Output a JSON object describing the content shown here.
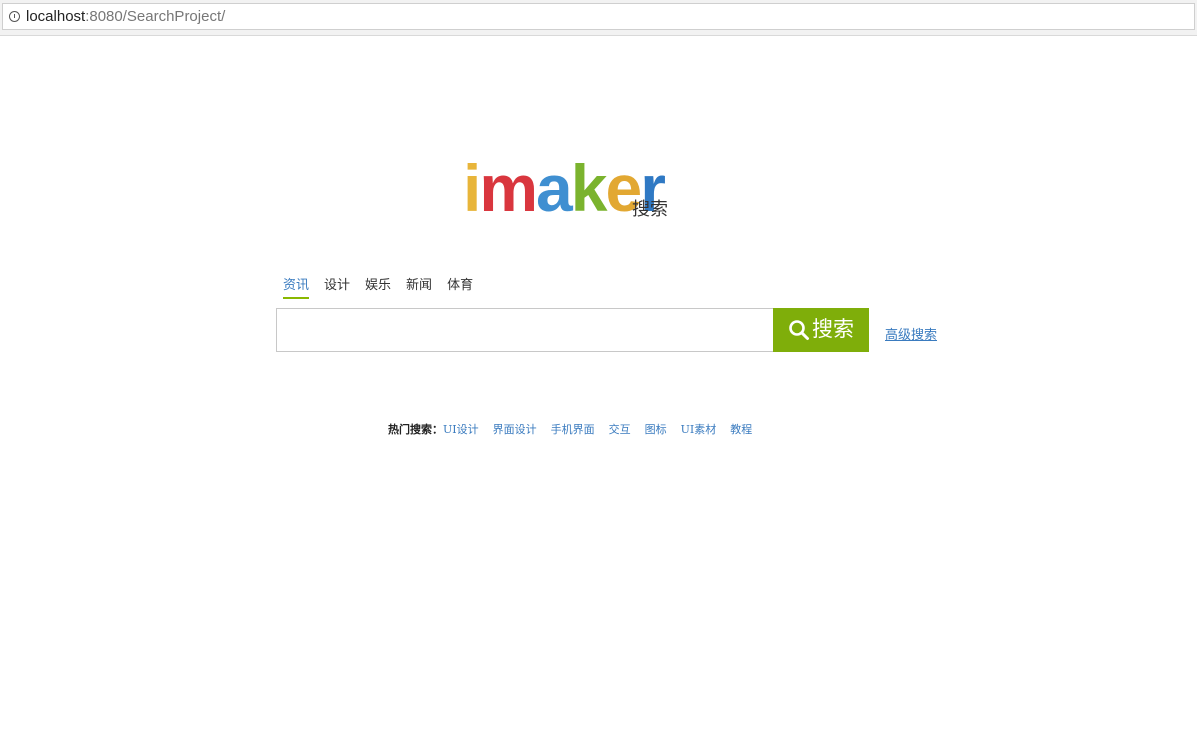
{
  "browser": {
    "url_host": "localhost",
    "url_rest": ":8080/SearchProject/"
  },
  "logo": {
    "letters": [
      {
        "char": "i",
        "color": "#e8b53a"
      },
      {
        "char": "m",
        "color": "#d9363e"
      },
      {
        "char": "a",
        "color": "#3f8fd1"
      },
      {
        "char": "k",
        "color": "#7bb32e"
      },
      {
        "char": "e",
        "color": "#e2a832"
      },
      {
        "char": "r",
        "color": "#2f79c4"
      }
    ],
    "sub": "搜索"
  },
  "tabs": [
    {
      "label": "资讯",
      "active": true
    },
    {
      "label": "设计",
      "active": false
    },
    {
      "label": "娱乐",
      "active": false
    },
    {
      "label": "新闻",
      "active": false
    },
    {
      "label": "体育",
      "active": false
    }
  ],
  "search": {
    "value": "",
    "button_label": "搜索",
    "advanced_label": "高级搜索"
  },
  "hot": {
    "label": "热门搜索：",
    "links": [
      "UI设计",
      "界面设计",
      "手机界面",
      "交互",
      "图标",
      "UI素材",
      "教程"
    ]
  },
  "colors": {
    "accent_green": "#7fae0a",
    "link_blue": "#3a7bbf"
  }
}
